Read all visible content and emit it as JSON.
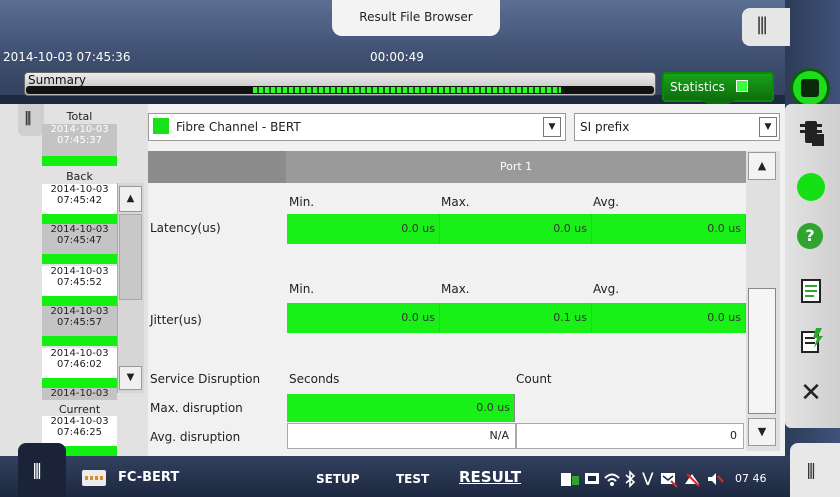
{
  "header": {
    "title": "Result File Browser",
    "datetime": "2014-10-03 07:45:36",
    "elapsed": "00:00:49",
    "summary_label": "Summary",
    "statistics_label": "Statistics"
  },
  "history": {
    "total_label": "Total",
    "total_entry": "2014-10-03\n07:45:37",
    "back_label": "Back",
    "items": [
      {
        "date": "2014-10-03",
        "time": "07:45:42"
      },
      {
        "date": "2014-10-03",
        "time": "07:45:47"
      },
      {
        "date": "2014-10-03",
        "time": "07:45:52"
      },
      {
        "date": "2014-10-03",
        "time": "07:45:57"
      },
      {
        "date": "2014-10-03",
        "time": "07:46:02"
      },
      {
        "date": "2014-10-03",
        "time": ""
      }
    ],
    "current_label": "Current",
    "current_entry": {
      "date": "2014-10-03",
      "time": "07:46:25"
    }
  },
  "main": {
    "test_select": "Fibre Channel - BERT",
    "prefix_select": "SI prefix",
    "port_label": "Port 1",
    "latency": {
      "label": "Latency(us)",
      "cols": [
        "Min.",
        "Max.",
        "Avg."
      ],
      "values": [
        "0.0 us",
        "0.0 us",
        "0.0 us"
      ]
    },
    "jitter": {
      "label": "Jitter(us)",
      "cols": [
        "Min.",
        "Max.",
        "Avg."
      ],
      "values": [
        "0.0 us",
        "0.1 us",
        "0.0 us"
      ]
    },
    "service_disruption": {
      "label": "Service Disruption",
      "col_seconds": "Seconds",
      "col_count": "Count",
      "max_label": "Max. disruption",
      "max_value": "0.0 us",
      "avg_label": "Avg. disruption",
      "avg_seconds": "N/A",
      "avg_count": "0"
    }
  },
  "bottom": {
    "module": "FC-BERT",
    "tabs": [
      "SETUP",
      "TEST",
      "RESULT"
    ],
    "clock": "07 46"
  },
  "colors": {
    "accent_green": "#18f018",
    "header_blue": "#3e4f70"
  },
  "icons": [
    "traffic-light-icon",
    "help-icon",
    "report-icon",
    "report-generate-icon",
    "close-icon",
    "stop-icon"
  ]
}
